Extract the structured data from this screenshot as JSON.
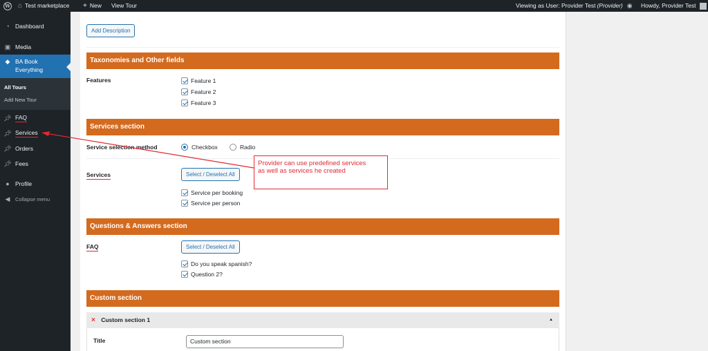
{
  "adminbar": {
    "site_name": "Test marketplace",
    "new_label": "New",
    "view_label": "View Tour",
    "viewing_as_prefix": "Viewing as User: Provider Test ",
    "viewing_as_role": "(Provider)",
    "howdy": "Howdy, Provider Test"
  },
  "sidebar": {
    "items": [
      {
        "label": "Dashboard",
        "icon": "dashboard-icon"
      },
      {
        "label": "Media",
        "icon": "media-icon"
      },
      {
        "label": "BA Book Everything",
        "line1": "BA Book",
        "line2": "Everything",
        "icon": "tag-icon",
        "active": true
      },
      {
        "label": "FAQ",
        "icon": "pin-icon"
      },
      {
        "label": "Services",
        "icon": "pin-icon"
      },
      {
        "label": "Orders",
        "icon": "pin-icon"
      },
      {
        "label": "Fees",
        "icon": "pin-icon"
      },
      {
        "label": "Profile",
        "icon": "user-icon"
      },
      {
        "label": "Collapse menu",
        "icon": "collapse-icon"
      }
    ],
    "submenu": [
      {
        "label": "All Tours",
        "current": true
      },
      {
        "label": "Add New Tour"
      }
    ]
  },
  "main": {
    "add_description_label": "Add Description",
    "taxonomies": {
      "title": "Taxonomies and Other fields",
      "features_label": "Features",
      "features": [
        {
          "label": "Feature 1",
          "checked": true
        },
        {
          "label": "Feature 2",
          "checked": true
        },
        {
          "label": "Feature 3",
          "checked": true
        }
      ]
    },
    "services": {
      "title": "Services section",
      "method_label": "Service selection method",
      "method_options": [
        {
          "label": "Checkbox",
          "selected": true
        },
        {
          "label": "Radio",
          "selected": false
        }
      ],
      "services_label": "Services",
      "select_all_label": "Select / Deselect All",
      "items": [
        {
          "label": "Service per booking",
          "checked": true
        },
        {
          "label": "Service per person",
          "checked": true
        }
      ]
    },
    "qa": {
      "title": "Questions & Answers section",
      "faq_label": "FAQ",
      "select_all_label": "Select / Deselect All",
      "items": [
        {
          "label": "Do you speak spanish?",
          "checked": true
        },
        {
          "label": "Question 2?",
          "checked": true
        }
      ]
    },
    "custom": {
      "title": "Custom section",
      "item_title": "Custom section 1",
      "remove_icon": "×",
      "collapse_icon": "▲",
      "field_label": "Title",
      "field_value": "Custom section"
    }
  },
  "annotation": {
    "text_line1": "Provider can use predefined services",
    "text_line2": "as well as services he created",
    "color": "#e3282f"
  },
  "colors": {
    "section_bar": "#d46a1e",
    "admin_dark": "#1d2327",
    "active_menu": "#2271b1"
  }
}
